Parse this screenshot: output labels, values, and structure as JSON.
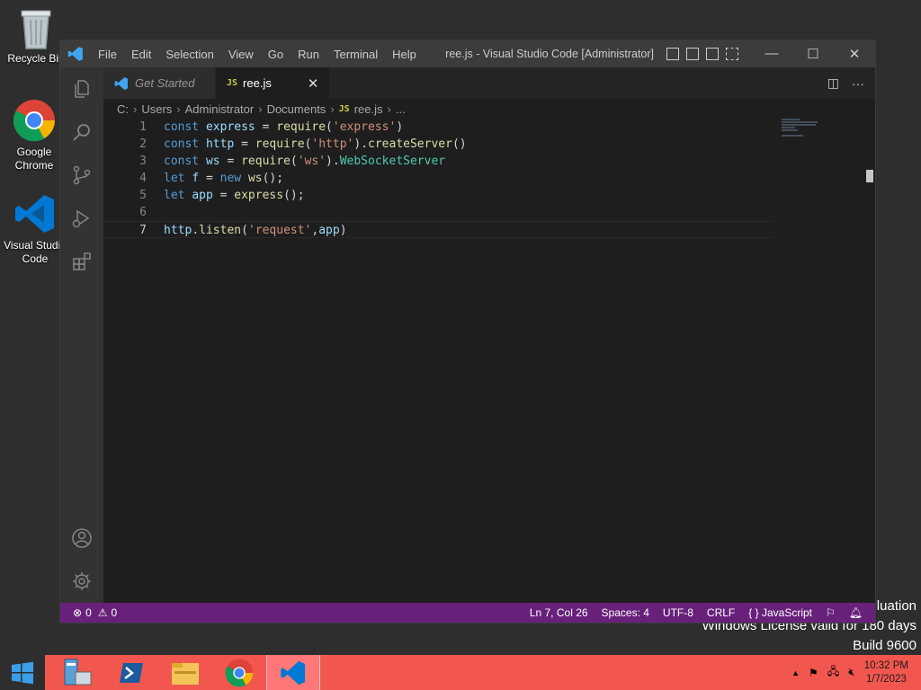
{
  "desktop": {
    "icons": [
      {
        "label": "Recycle Bin"
      },
      {
        "label": "Google Chrome"
      },
      {
        "label": "Visual Studio Code"
      }
    ],
    "watermark": {
      "line1": "luation",
      "line2": "Windows License valid for 180 days",
      "line3": "Build 9600"
    }
  },
  "vscode": {
    "menu": [
      "File",
      "Edit",
      "Selection",
      "View",
      "Go",
      "Run",
      "Terminal",
      "Help"
    ],
    "title": "ree.js - Visual Studio Code [Administrator]",
    "tabs": [
      {
        "label": "Get Started"
      },
      {
        "label": "ree.js",
        "badge": "JS"
      }
    ],
    "breadcrumb": [
      "C:",
      "Users",
      "Administrator",
      "Documents",
      "ree.js",
      "..."
    ],
    "code_lines": [
      {
        "n": "1",
        "text": "const express = require('express')"
      },
      {
        "n": "2",
        "text": "const http = require('http').createServer()"
      },
      {
        "n": "3",
        "text": "const ws = require('ws').WebSocketServer"
      },
      {
        "n": "4",
        "text": "let f = new ws();"
      },
      {
        "n": "5",
        "text": "let app = express();"
      },
      {
        "n": "6",
        "text": ""
      },
      {
        "n": "7",
        "text": "http.listen('request',app)"
      }
    ],
    "status": {
      "errors": "0",
      "warnings": "0",
      "position": "Ln 7, Col 26",
      "spaces": "Spaces: 4",
      "encoding": "UTF-8",
      "eol": "CRLF",
      "language": "JavaScript"
    },
    "colors": {
      "statusbar": "#68217a",
      "accent": "#007acc"
    }
  },
  "taskbar": {
    "clock_time": "10:32 PM",
    "clock_date": "1/7/2023",
    "color": "#f2574f"
  }
}
